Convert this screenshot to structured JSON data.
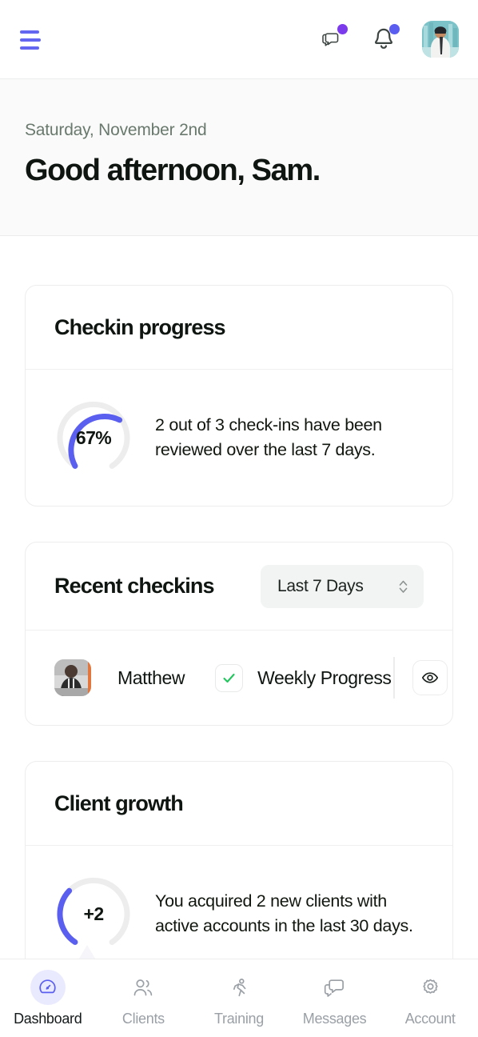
{
  "topbar": {
    "menu_icon": "hamburger-menu-icon",
    "messages_icon": "chat-bubbles-icon",
    "messages_badge": true,
    "notifications_icon": "bell-icon",
    "notifications_badge": true,
    "avatar_alt": "Sam profile photo"
  },
  "greeting": {
    "date": "Saturday, November 2nd",
    "title": "Good afternoon, Sam."
  },
  "cards": {
    "checkin_progress": {
      "title": "Checkin progress",
      "gauge_value": "67%",
      "gauge_percent": 67,
      "description": "2 out of 3 check-ins have been reviewed over the last 7 days."
    },
    "recent_checkins": {
      "title": "Recent checkins",
      "range_select": {
        "value": "Last 7 Days",
        "icon": "chevron-up-down-icon"
      },
      "rows": [
        {
          "client": "Matthew",
          "status_icon": "check-icon",
          "type": "Weekly Progress",
          "view_icon": "eye-icon"
        }
      ]
    },
    "client_growth": {
      "title": "Client growth",
      "gauge_value": "+2",
      "gauge_percent": 28,
      "description": "You acquired 2 new clients with active accounts in the last 30 days."
    }
  },
  "bottomnav": {
    "items": [
      {
        "label": "Dashboard",
        "icon": "gauge-icon",
        "active": true
      },
      {
        "label": "Clients",
        "icon": "people-icon",
        "active": false
      },
      {
        "label": "Training",
        "icon": "running-person-icon",
        "active": false
      },
      {
        "label": "Messages",
        "icon": "chat-bubbles-icon",
        "active": false
      },
      {
        "label": "Account",
        "icon": "gear-icon",
        "active": false
      }
    ]
  },
  "colors": {
    "accent": "#6366f1",
    "accent_badge": "#7c3aed",
    "success": "#22c55e",
    "text": "#0f1511",
    "muted": "#69796d",
    "track": "#ededed"
  }
}
